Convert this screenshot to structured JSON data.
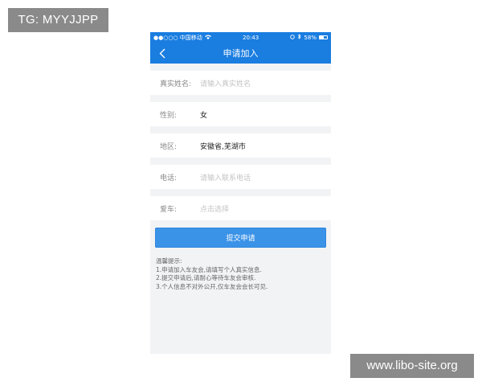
{
  "watermarks": {
    "top_left": "TG: MYYJJPP",
    "bottom_right": "www.libo-site.org"
  },
  "status_bar": {
    "carrier": "●●○○○ 中国移动",
    "wifi_icon": "wifi-icon",
    "time": "20:43",
    "battery_percent_text": "58%",
    "battery_level": 0.58
  },
  "nav": {
    "title": "申请加入",
    "back_icon": "chevron-left-icon"
  },
  "form": {
    "name": {
      "label": "真实姓名:",
      "placeholder": "请输入真实姓名"
    },
    "gender": {
      "label": "性别:",
      "value": "女"
    },
    "region": {
      "label": "地区:",
      "value": "安徽省,芜湖市"
    },
    "phone": {
      "label": "电话:",
      "placeholder": "请输入联系电话"
    },
    "car": {
      "label": "爱车:",
      "placeholder": "点击选择"
    }
  },
  "submit_label": "提交申请",
  "tips": {
    "title": "温馨提示:",
    "lines": [
      "1.申请加入车友会,请填写个人真实信息.",
      "2.提交申请后,请耐心等待车友会审核.",
      "3.个人信息不对外公开,仅车友会会长可见."
    ]
  },
  "colors": {
    "primary": "#1a7de0",
    "button": "#3b93e8",
    "background": "#f2f3f5"
  }
}
